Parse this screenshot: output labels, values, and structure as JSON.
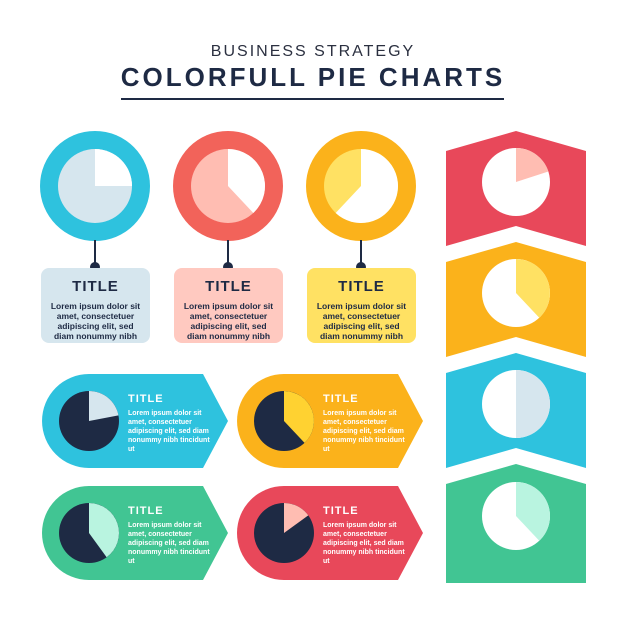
{
  "header": {
    "subtitle": "BUSINESS STRATEGY",
    "title": "COLORFULL PIE CHARTS"
  },
  "cards": [
    {
      "title": "TITLE",
      "body": "Lorem ipsum dolor sit amet, consectetuer adipiscing elit, sed diam nonummy nibh",
      "color": "#2ec2de",
      "pie_fraction": 0.25
    },
    {
      "title": "TITLE",
      "body": "Lorem ipsum dolor sit amet, consectetuer adipiscing elit, sed diam nonummy nibh",
      "color": "#f2635a",
      "pie_fraction": 0.38
    },
    {
      "title": "TITLE",
      "body": "Lorem ipsum dolor sit amet, consectetuer adipiscing elit, sed diam nonummy nibh",
      "color": "#fbb21b",
      "pie_fraction": 0.62
    }
  ],
  "labels": [
    {
      "title": "TITLE",
      "body": "Lorem ipsum dolor sit amet, consectetuer adipiscing elit, sed diam nonummy nibh tincidunt ut",
      "color": "#2ec2de",
      "pie_fraction": 0.22
    },
    {
      "title": "TITLE",
      "body": "Lorem ipsum dolor sit amet, consectetuer adipiscing elit, sed diam nonummy nibh tincidunt ut",
      "color": "#fbb21b",
      "pie_fraction": 0.38
    },
    {
      "title": "TITLE",
      "body": "Lorem ipsum dolor sit amet, consectetuer adipiscing elit, sed diam nonummy nibh tincidunt ut",
      "color": "#41c593",
      "pie_fraction": 0.4
    },
    {
      "title": "TITLE",
      "body": "Lorem ipsum dolor sit amet, consectetuer adipiscing elit, sed diam nonummy nibh tincidunt ut",
      "color": "#e8485a",
      "pie_fraction": 0.15
    }
  ],
  "banners": [
    {
      "color": "#e8485a",
      "pie_fraction": 0.2
    },
    {
      "color": "#fbb21b",
      "pie_fraction": 0.38
    },
    {
      "color": "#2ec2de",
      "pie_fraction": 0.5
    },
    {
      "color": "#41c593",
      "pie_fraction": 0.38
    }
  ]
}
